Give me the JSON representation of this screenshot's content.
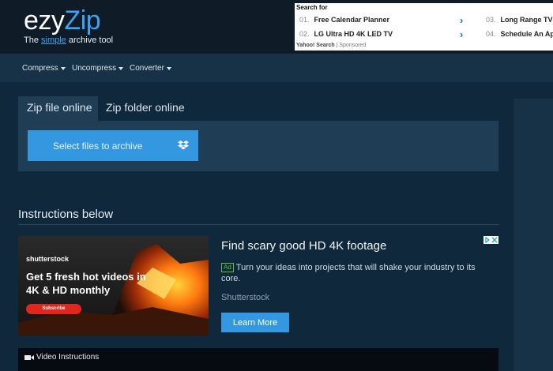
{
  "logo": {
    "part1": "ezy",
    "part2": "Zip",
    "tag_prefix": "The ",
    "tag_highlight": "simple",
    "tag_suffix": " archive tool"
  },
  "top_ad": {
    "search_for": "Search for",
    "items": [
      {
        "num": "01.",
        "text": "Free Calendar Planner"
      },
      {
        "num": "02.",
        "text": "LG Ultra HD 4K LED TV"
      },
      {
        "num": "03.",
        "text": "Long Range TV"
      },
      {
        "num": "04.",
        "text": "Schedule An Ap"
      }
    ],
    "footer_brand": "Yahoo! Search",
    "footer_sep": " | ",
    "footer_label": "Sponsored"
  },
  "nav": {
    "items": [
      "Compress",
      "Uncompress",
      "Converter"
    ]
  },
  "tabs": {
    "active": "Zip file online",
    "inactive": "Zip folder online"
  },
  "upload": {
    "select_label": "Select files to archive",
    "icon": "dropbox-icon"
  },
  "instructions": {
    "title": "Instructions below"
  },
  "ad": {
    "image_brand": "shutterstock",
    "image_headline": "Get 5 fresh hot videos in 4K & HD monthly",
    "image_button": "Subscribe",
    "title": "Find scary good HD 4K footage",
    "badge": "Ad",
    "description": "Turn your ideas into projects that will shake your industry to its core.",
    "source": "Shutterstock",
    "cta": "Learn More"
  },
  "video": {
    "label": "Video Instructions"
  },
  "colors": {
    "accent": "#3498e0",
    "brand_blue": "#3ea3ef",
    "header_bg": "#0f1b26",
    "page_bg": "#10283b",
    "panel_bg": "#1f3e55"
  }
}
